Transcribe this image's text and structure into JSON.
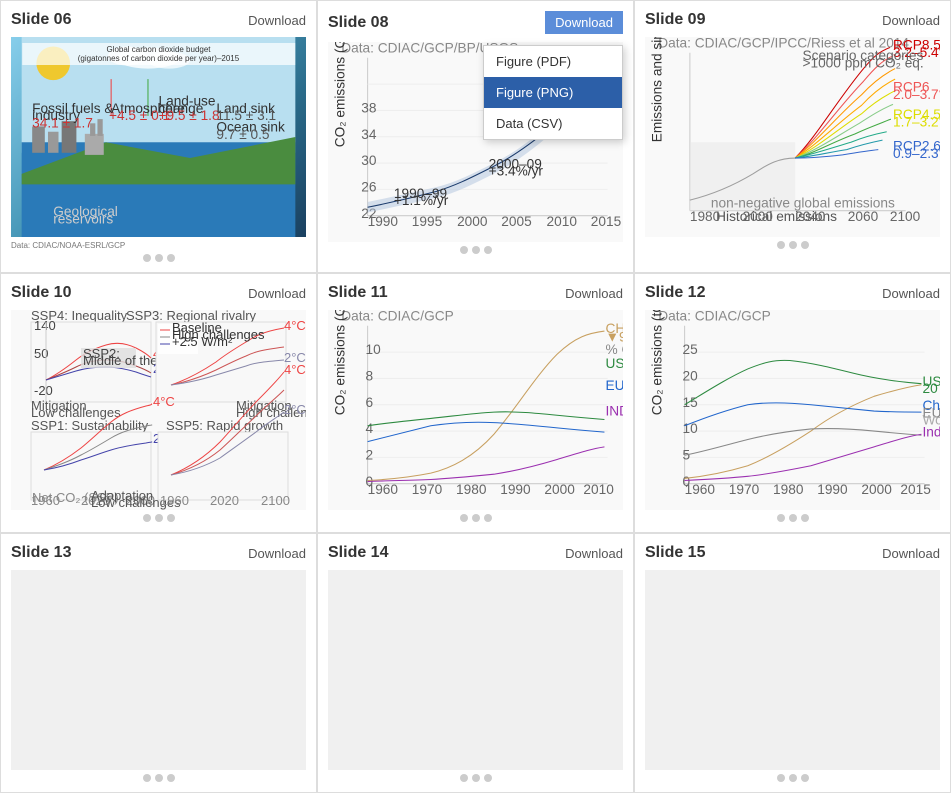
{
  "slides": [
    {
      "id": "slide-06",
      "title": "Slide 06",
      "download_label": "Download",
      "type": "diagram",
      "data_source": "Data: CDIAC/NOAA-ESRL/GCP",
      "nav_dots": 3
    },
    {
      "id": "slide-08",
      "title": "Slide 08",
      "download_label": "Download",
      "has_dropdown": true,
      "type": "line_chart",
      "data_source": "Data: CDIAC/GCP/BP/USGS",
      "nav_dots": 3,
      "chart_labels": [
        "1990",
        "1995",
        "2000",
        "2005",
        "2010",
        "2015"
      ],
      "annotations": [
        "1990–99\n+1.1%/yr",
        "2000–09\n+3.4%/yr"
      ]
    },
    {
      "id": "slide-09",
      "title": "Slide 09",
      "download_label": "Download",
      "type": "multiline_chart",
      "data_source": "Data: CDIAC/GCP/IPCC/Riess et al 2014",
      "nav_dots": 3
    },
    {
      "id": "slide-10",
      "title": "Slide 10",
      "download_label": "Download",
      "type": "scenario_chart",
      "data_source": "",
      "nav_dots": 3
    },
    {
      "id": "slide-11",
      "title": "Slide 11",
      "download_label": "Download",
      "type": "country_line_chart",
      "data_source": "Data: CDIAC/GCP",
      "nav_dots": 3
    },
    {
      "id": "slide-12",
      "title": "Slide 12",
      "download_label": "Download",
      "type": "percapita_chart",
      "data_source": "Data: CDIAC/GCP",
      "nav_dots": 3
    },
    {
      "id": "slide-13",
      "title": "Slide 13",
      "download_label": "Download",
      "type": "placeholder",
      "data_source": "",
      "nav_dots": 3
    },
    {
      "id": "slide-14",
      "title": "Slide 14",
      "download_label": "Download",
      "type": "placeholder",
      "data_source": "",
      "nav_dots": 3
    },
    {
      "id": "slide-15",
      "title": "Slide 15",
      "download_label": "Download",
      "type": "placeholder",
      "data_source": "",
      "nav_dots": 3
    }
  ],
  "dropdown": {
    "trigger_label": "Download",
    "items": [
      {
        "label": "Figure (PDF)",
        "id": "pdf",
        "active": false
      },
      {
        "label": "Figure (PNG)",
        "id": "png",
        "active": true
      },
      {
        "label": "Data (CSV)",
        "id": "csv",
        "active": false
      }
    ]
  }
}
